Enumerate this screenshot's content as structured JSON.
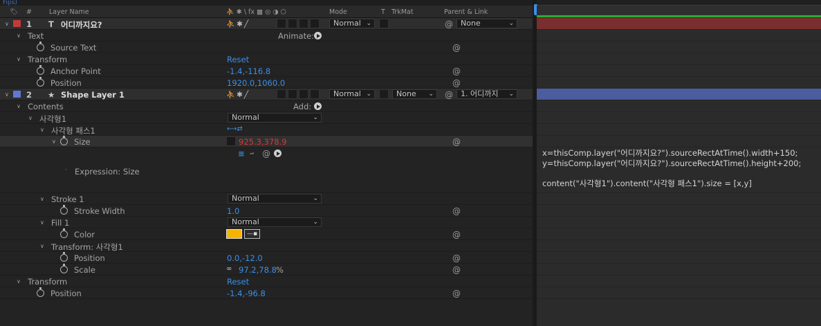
{
  "top_strip": "Fips)",
  "header": {
    "hash": "#",
    "layer_name": "Layer Name",
    "switches": "⛹ ✱ \\ fx ▩ ◎ ◑ ⬡",
    "mode": "Mode",
    "t": "T",
    "trkmat": "TrkMat",
    "parent": "Parent & Link"
  },
  "layers": {
    "l1": {
      "num": "1",
      "type_glyph": "T",
      "name": "어디까지요?",
      "mode": "Normal",
      "parent": "None",
      "color": "#c23b3b"
    },
    "text": {
      "label": "Text",
      "animate": "Animate:"
    },
    "source_text": {
      "label": "Source Text"
    },
    "transform1": {
      "label": "Transform",
      "reset": "Reset"
    },
    "anchor": {
      "label": "Anchor Point",
      "value": "-1.4,-116.8"
    },
    "position1": {
      "label": "Position",
      "value": "1920.0,1060.0"
    },
    "l2": {
      "num": "2",
      "type_glyph": "★",
      "name": "Shape Layer 1",
      "mode": "Normal",
      "trkmat": "None",
      "parent": "1. 어디까지",
      "color": "#6078d4"
    },
    "contents": {
      "label": "Contents",
      "add": "Add:"
    },
    "rect": {
      "label": "사각형1",
      "mode": "Normal"
    },
    "path": {
      "label": "사각형 패스1"
    },
    "size": {
      "label": "Size",
      "value": "925.3,378.9"
    },
    "expression": {
      "label": "Expression: Size"
    },
    "stroke": {
      "label": "Stroke 1",
      "mode": "Normal"
    },
    "stroke_width": {
      "label": "Stroke Width",
      "value": "1.0"
    },
    "fill": {
      "label": "Fill 1",
      "mode": "Normal"
    },
    "color": {
      "label": "Color",
      "swatch": "#f5b400"
    },
    "transform_rect": {
      "label": "Transform: 사각형1"
    },
    "position_rect": {
      "label": "Position",
      "value": "0.0,-12.0"
    },
    "scale": {
      "label": "Scale",
      "value": "97.2,78.8",
      "unit": "%"
    },
    "transform2": {
      "label": "Transform",
      "reset": "Reset"
    },
    "position2": {
      "label": "Position",
      "value": "-1.4,-96.8"
    }
  },
  "expression_text": "x=thisComp.layer(\"어디까지요?\").sourceRectAtTime().width+150;\ny=thisComp.layer(\"어디까지요?\").sourceRectAtTime().height+200;\n\ncontent(\"사각형1\").content(\"사각형 패스1\").size = [x,y]",
  "colors": {
    "accent_blue": "#3b8fe8",
    "layer1_bar": "#7a2e2e",
    "layer2_bar": "#4b5d9e",
    "work_area": "#2faa3a"
  }
}
